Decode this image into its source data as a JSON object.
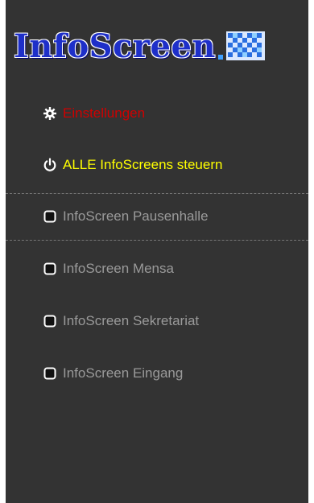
{
  "logo": {
    "text": "InfoScreen",
    "icon": "pixel-grid-icon"
  },
  "colors": {
    "panel_bg": "#333333",
    "settings": "#d00000",
    "all_control": "#ffff00",
    "screen_item": "#9a9a9a",
    "logo_blue": "#1e2fc9"
  },
  "menu": {
    "settings": {
      "label": "Einstellungen",
      "icon": "gear-icon"
    },
    "all_control": {
      "label": "ALLE InfoScreens steuern",
      "icon": "power-icon"
    },
    "screens": [
      {
        "label": "InfoScreen Pausenhalle",
        "icon": "screen-icon"
      },
      {
        "label": "InfoScreen Mensa",
        "icon": "screen-icon"
      },
      {
        "label": "InfoScreen Sekretariat",
        "icon": "screen-icon"
      },
      {
        "label": "InfoScreen Eingang",
        "icon": "screen-icon"
      }
    ]
  }
}
